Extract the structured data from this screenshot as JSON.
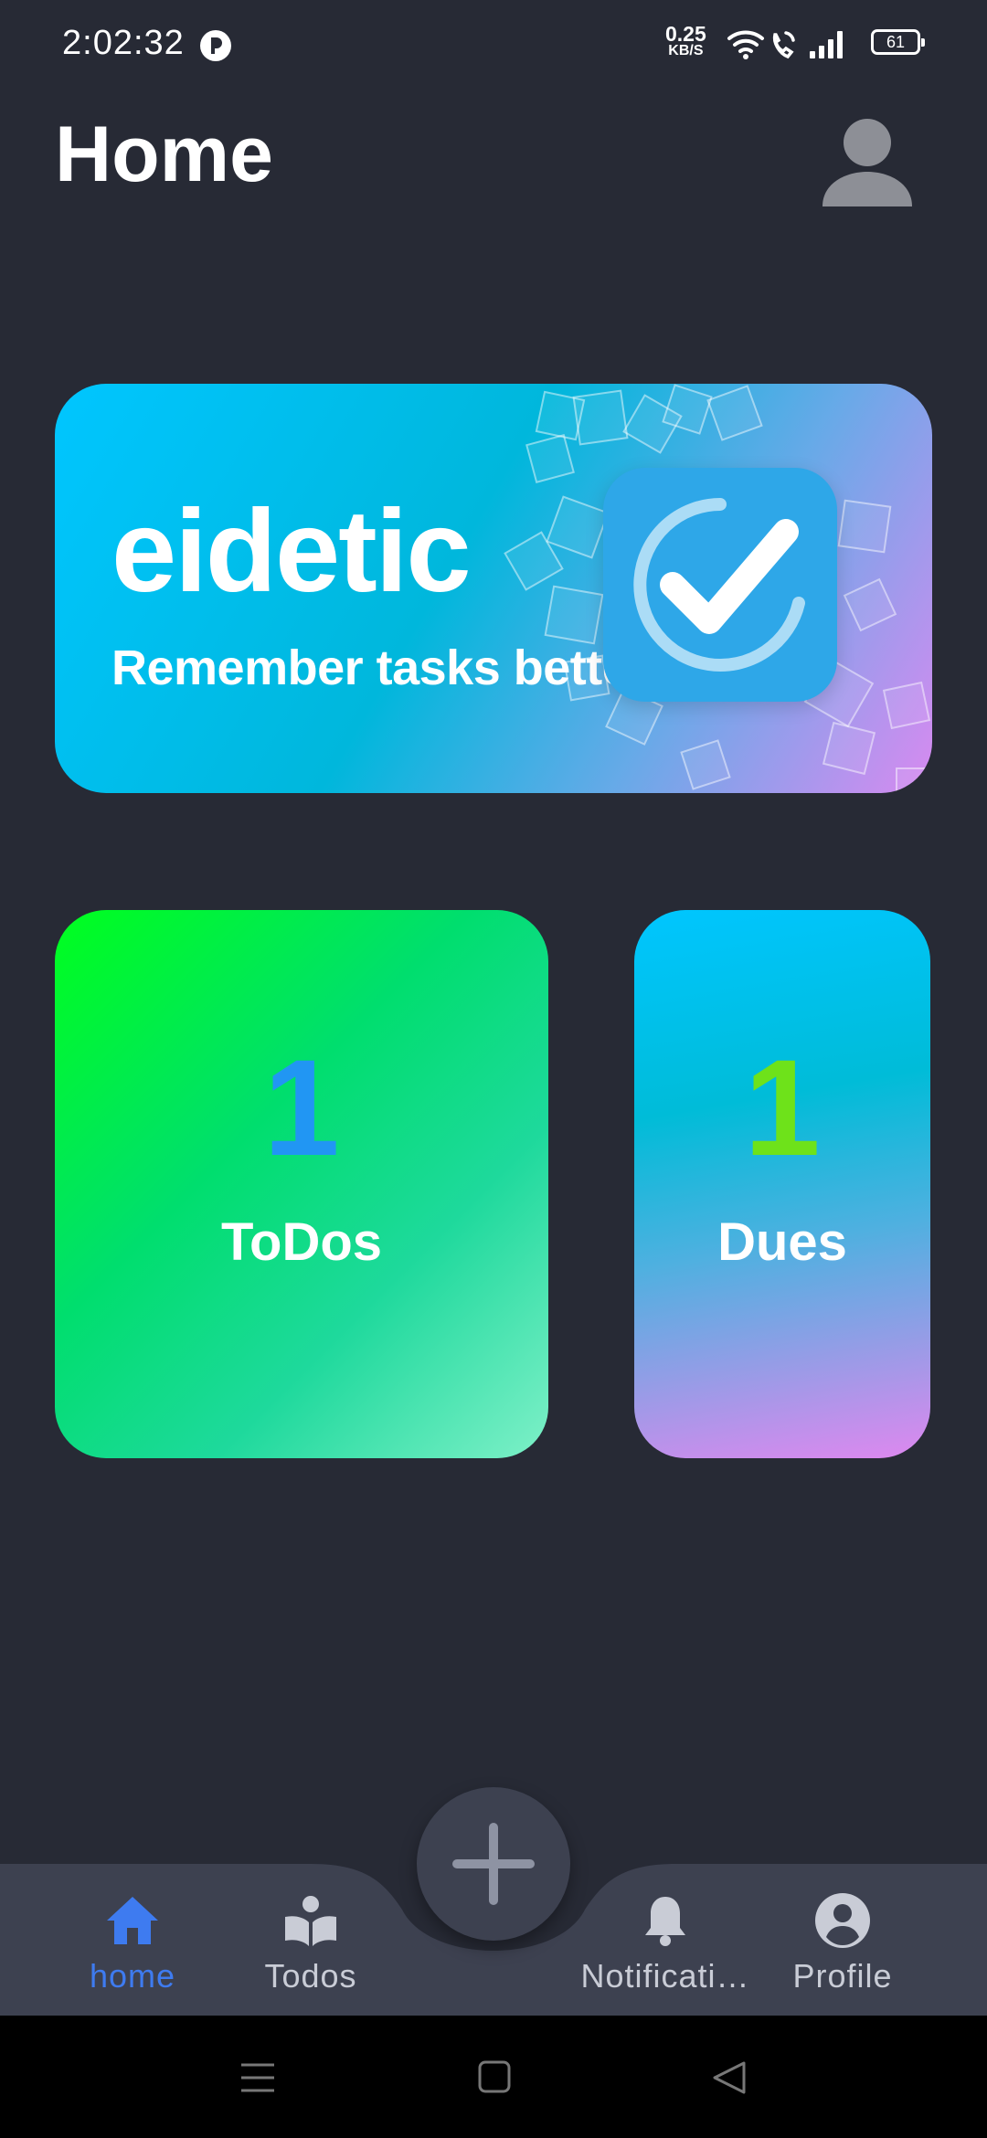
{
  "status_bar": {
    "time": "2:02:32",
    "net_speed": "0.25",
    "net_unit": "KB/S",
    "battery": "61"
  },
  "header": {
    "title": "Home"
  },
  "banner": {
    "title": "eidetic",
    "subtitle": "Remember tasks better"
  },
  "cards": {
    "todos": {
      "count": "1",
      "label": "ToDos",
      "count_color": "#2196f3"
    },
    "dues": {
      "count": "1",
      "label": "Dues",
      "count_color": "#6ee21a"
    }
  },
  "bottom_nav": {
    "items": [
      {
        "label": "home",
        "icon": "home-icon",
        "active": true
      },
      {
        "label": "Todos",
        "icon": "reader-icon",
        "active": false
      },
      {
        "label": "Notificati…",
        "icon": "bell-icon",
        "active": false
      },
      {
        "label": "Profile",
        "icon": "account-circle-icon",
        "active": false
      }
    ],
    "fab_icon": "plus-icon"
  },
  "colors": {
    "background": "#272a35",
    "nav_background": "#3d4150",
    "active": "#3e7bf0"
  }
}
